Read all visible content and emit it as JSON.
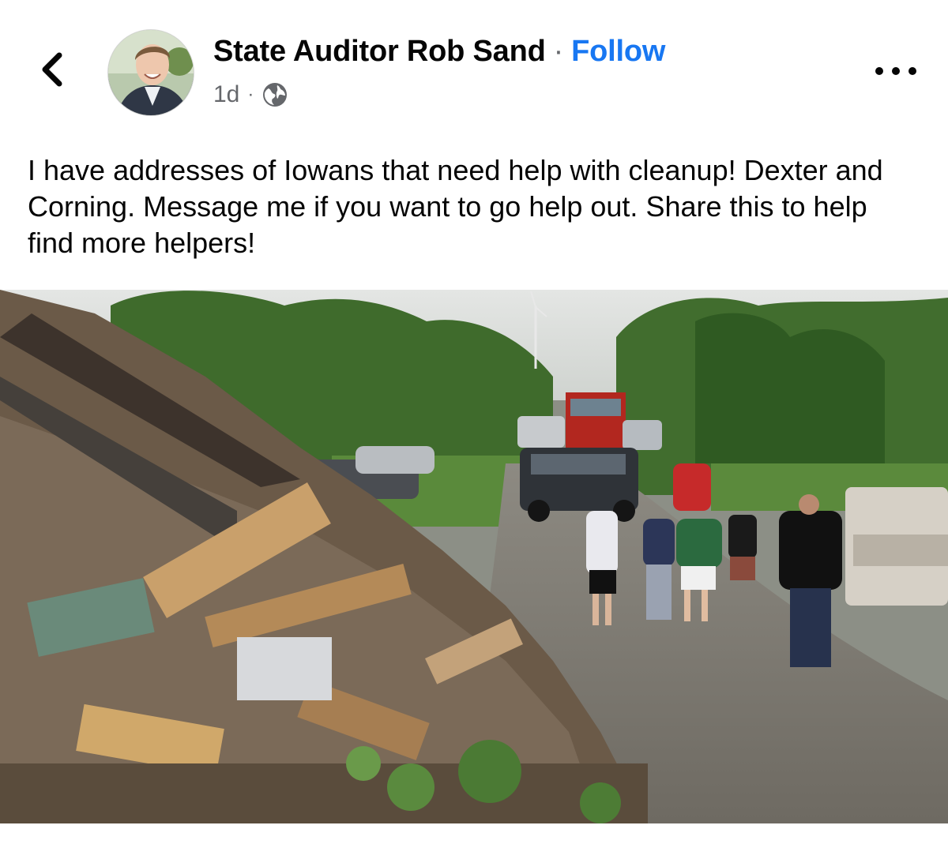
{
  "header": {
    "author_name": "State Auditor Rob Sand",
    "separator": "·",
    "follow_label": "Follow",
    "timestamp": "1d",
    "meta_separator": "·",
    "privacy_icon": "globe-icon",
    "back_icon": "chevron-left-icon",
    "more_icon": "more-horizontal-icon"
  },
  "post": {
    "text": "I have addresses of Iowans that need help with cleanup! Dexter and Corning. Message me if you want to go help out. Share this to help find more helpers!"
  },
  "colors": {
    "accent": "#1877f2",
    "secondary_text": "#65676b",
    "primary_text": "#050505"
  }
}
